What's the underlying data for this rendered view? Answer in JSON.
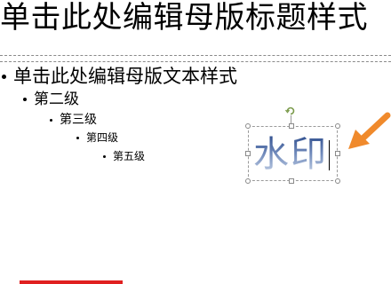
{
  "slide": {
    "title": "单击此处编辑母版标题样式",
    "levels": [
      {
        "level": 1,
        "text": "单击此处编辑母版文本样式"
      },
      {
        "level": 2,
        "text": "第二级"
      },
      {
        "level": 3,
        "text": "第三级"
      },
      {
        "level": 4,
        "text": "第四级"
      },
      {
        "level": 5,
        "text": "第五级"
      }
    ],
    "watermark": {
      "text": "水印",
      "selected": true,
      "editing": true
    }
  },
  "icons": {
    "rotate": "rotate-handle-icon",
    "arrow": "orange-pointer-arrow-icon"
  },
  "colors": {
    "arrow": "#f08a2c",
    "watermark_top": "#2b4a8a",
    "watermark_bottom": "#c9d6ea",
    "selection_border": "#9a9a9a",
    "accent_bar": "#e02020"
  }
}
